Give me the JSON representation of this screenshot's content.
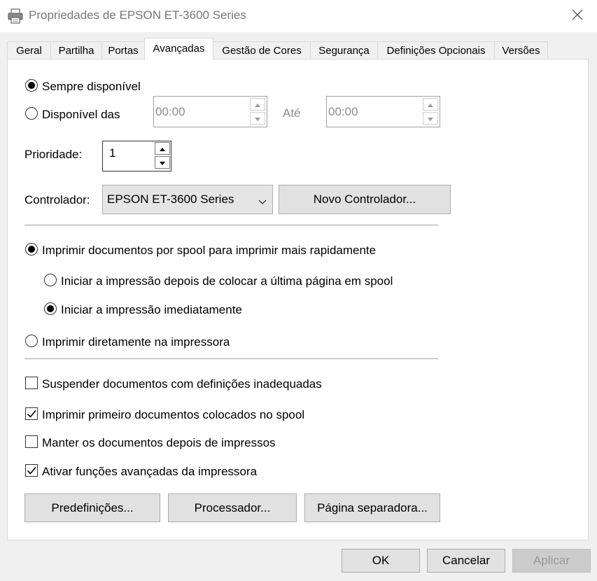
{
  "window": {
    "title": "Propriedades de EPSON ET-3600 Series"
  },
  "tabs": [
    {
      "label": "Geral"
    },
    {
      "label": "Partilha"
    },
    {
      "label": "Portas"
    },
    {
      "label": "Avançadas"
    },
    {
      "label": "Gestão de Cores"
    },
    {
      "label": "Segurança"
    },
    {
      "label": "Definições Opcionais"
    },
    {
      "label": "Versões"
    }
  ],
  "availability": {
    "always_label": "Sempre disponível",
    "always_selected": true,
    "from_label": "Disponível das",
    "from_value": "00:00",
    "until_label": "Até",
    "until_value": "00:00"
  },
  "priority": {
    "label": "Prioridade:",
    "value": "1"
  },
  "driver": {
    "label": "Controlador:",
    "selected": "EPSON ET-3600 Series",
    "new_button": "Novo Controlador..."
  },
  "spool": {
    "spool_label": "Imprimir documentos por spool para imprimir mais rapidamente",
    "spool_selected": true,
    "after_last_label": "Iniciar a impressão depois de colocar a última página em spool",
    "immediately_label": "Iniciar a impressão imediatamente",
    "immediately_selected": true,
    "direct_label": "Imprimir diretamente na impressora"
  },
  "options": [
    {
      "label": "Suspender documentos com definições inadequadas",
      "checked": false
    },
    {
      "label": "Imprimir primeiro documentos colocados no spool",
      "checked": true
    },
    {
      "label": "Manter os documentos depois de impressos",
      "checked": false
    },
    {
      "label": "Ativar funções avançadas da impressora",
      "checked": true
    }
  ],
  "panel_buttons": {
    "defaults": "Predefinições...",
    "processor": "Processador...",
    "separator": "Página separadora..."
  },
  "footer": {
    "ok": "OK",
    "cancel": "Cancelar",
    "apply": "Aplicar"
  },
  "colors": {
    "panel": "#ffffff",
    "window": "#f0f0f0",
    "disabled_text": "#9a9a9a"
  }
}
